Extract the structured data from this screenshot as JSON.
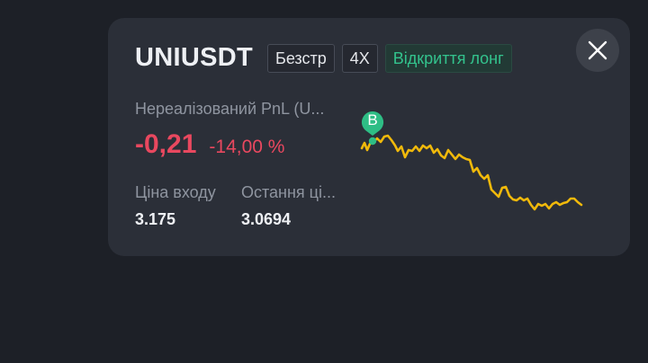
{
  "position": {
    "symbol": "UNIUSDT",
    "tags": [
      "Безстр",
      "4X",
      "Відкриття лонг"
    ],
    "pnl_label": "Нереалізований PnL (U...",
    "pnl_value": "-0,21",
    "pnl_percent": "-14,00 %",
    "entry_label": "Ціна входу",
    "entry_value": "3.175",
    "last_label": "Остання ці...",
    "last_value": "3.0694"
  },
  "chart": {
    "marker_label": "B",
    "line_color": "#f0b90b",
    "marker_color": "#2ebd85"
  },
  "colors": {
    "negative": "#e9485f",
    "long_tag": "#33c38d"
  },
  "icons": {
    "close": "close-icon"
  }
}
